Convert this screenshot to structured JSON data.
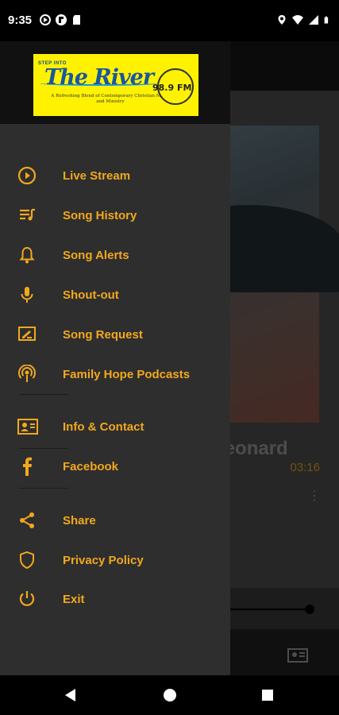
{
  "status_bar": {
    "time": "9:35",
    "left_icons": [
      "media-icon",
      "flipboard-icon",
      "sd-card-icon"
    ],
    "right_icons": [
      "location-icon",
      "wifi-icon",
      "signal-icon",
      "battery-icon"
    ]
  },
  "logo": {
    "step_text": "STEP INTO",
    "title": "The River",
    "tagline": "A Refreshing Blend of Contemporary Christian Music and Ministry",
    "frequency": "98.9 FM"
  },
  "menu": {
    "items": [
      {
        "label": "Live Stream",
        "icon": "play-circle-icon"
      },
      {
        "label": "Song History",
        "icon": "playlist-icon"
      },
      {
        "label": "Song Alerts",
        "icon": "bell-icon"
      },
      {
        "label": "Shout-out",
        "icon": "microphone-icon"
      },
      {
        "label": "Song Request",
        "icon": "request-icon"
      },
      {
        "label": "Family Hope Podcasts",
        "icon": "podcast-icon"
      },
      {
        "label": "Info & Contact",
        "icon": "contact-card-icon"
      },
      {
        "label": "Facebook",
        "icon": "facebook-icon"
      },
      {
        "label": "Share",
        "icon": "share-icon"
      },
      {
        "label": "Privacy Policy",
        "icon": "shield-icon"
      },
      {
        "label": "Exit",
        "icon": "power-icon"
      }
    ]
  },
  "background": {
    "album_text": "David Leonard",
    "elapsed_time": "03:16"
  },
  "colors": {
    "accent": "#f2a81d",
    "drawer_bg": "#2e2e2e",
    "logo_bg": "#fff200"
  }
}
